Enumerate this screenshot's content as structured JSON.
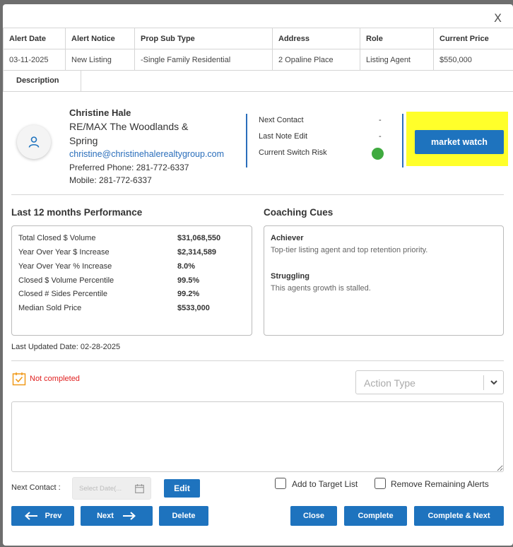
{
  "modal": {
    "close_label": "X"
  },
  "alert_table": {
    "headers": [
      "Alert Date",
      "Alert Notice",
      "Prop Sub Type",
      "Address",
      "Role",
      "Current Price"
    ],
    "row": [
      "03-11-2025",
      "New Listing",
      "-Single Family Residential",
      "2 Opaline Place",
      "Listing Agent",
      "$550,000"
    ],
    "description_label": "Description"
  },
  "agent": {
    "name": "Christine Hale",
    "office_line1": "RE/MAX The Woodlands &",
    "office_line2": "Spring",
    "email": "christine@christinehalerealtygroup.com",
    "preferred_phone": "Preferred Phone: 281-772-6337",
    "mobile": "Mobile: 281-772-6337",
    "avatar_icon": "user-icon"
  },
  "contact_info": {
    "next_contact_label": "Next Contact",
    "next_contact_value": "-",
    "last_note_label": "Last Note Edit",
    "last_note_value": "-",
    "switch_risk_label": "Current Switch Risk",
    "switch_risk_color": "#3faa3f"
  },
  "market_watch": {
    "label": "market watch",
    "highlight_color": "#ffff2a"
  },
  "performance": {
    "title": "Last 12 months Performance",
    "rows": [
      {
        "label": "Total Closed $ Volume",
        "value": "$31,068,550"
      },
      {
        "label": "Year Over Year $ Increase",
        "value": "$2,314,589"
      },
      {
        "label": "Year Over Year % Increase",
        "value": "8.0%"
      },
      {
        "label": "Closed $ Volume Percentile",
        "value": "99.5%"
      },
      {
        "label": "Closed # Sides Percentile",
        "value": "99.2%"
      },
      {
        "label": "Median Sold Price",
        "value": "$533,000"
      }
    ],
    "updated": "Last Updated Date: 02-28-2025"
  },
  "coaching": {
    "title": "Coaching Cues",
    "cues": [
      {
        "heading": "Achiever",
        "text": "Top-tier listing agent and top retention priority."
      },
      {
        "heading": "Struggling",
        "text": "This agents growth is stalled."
      }
    ]
  },
  "status": {
    "label": "Not completed",
    "color": "#e02020"
  },
  "action_type": {
    "placeholder": "Action Type"
  },
  "next_contact_row": {
    "label": "Next Contact :",
    "date_placeholder": "Select Date(...",
    "edit_label": "Edit",
    "add_target_label": "Add to Target List",
    "remove_alerts_label": "Remove Remaining Alerts"
  },
  "footer": {
    "prev_label": "Prev",
    "next_label": "Next",
    "delete_label": "Delete",
    "close_label": "Close",
    "complete_label": "Complete",
    "complete_next_label": "Complete & Next"
  },
  "colors": {
    "primary": "#1e73be",
    "accent_link": "#2a6ebb"
  }
}
